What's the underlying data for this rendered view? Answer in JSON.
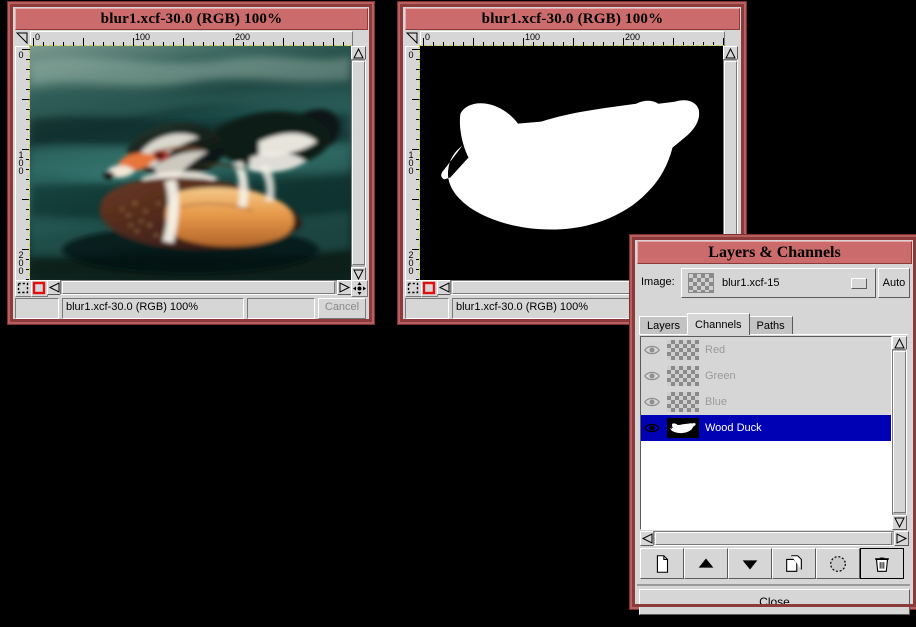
{
  "windows": [
    {
      "title": "blur1.xcf-30.0 (RGB) 100%",
      "status_text": "blur1.xcf-30.0 (RGB) 100%",
      "cancel_label": "Cancel",
      "ruler_labels_h": [
        "0",
        "100",
        "200"
      ],
      "ruler_labels_v": [
        "0",
        "100",
        "200"
      ],
      "canvas_kind": "photo-wood-duck"
    },
    {
      "title": "blur1.xcf-30.0 (RGB) 100%",
      "status_text": "blur1.xcf-30.0 (RGB) 100%",
      "cancel_label": "",
      "ruler_labels_h": [
        "0",
        "100",
        "200"
      ],
      "ruler_labels_v": [
        "0",
        "100",
        "200"
      ],
      "canvas_kind": "mask-duck-silhouette"
    }
  ],
  "dialog": {
    "title": "Layers & Channels",
    "image_label": "Image:",
    "image_value": "blur1.xcf-15",
    "auto_label": "Auto",
    "tabs": [
      {
        "label": "Layers",
        "active": false
      },
      {
        "label": "Channels",
        "active": true
      },
      {
        "label": "Paths",
        "active": false
      }
    ],
    "channels": [
      {
        "name": "Red",
        "selected": false,
        "visible": true,
        "thumb": "checker"
      },
      {
        "name": "Green",
        "selected": false,
        "visible": true,
        "thumb": "checker"
      },
      {
        "name": "Blue",
        "selected": false,
        "visible": true,
        "thumb": "checker"
      },
      {
        "name": "Wood Duck",
        "selected": true,
        "visible": true,
        "thumb": "mask"
      }
    ],
    "toolbar": [
      {
        "icon": "new-channel-icon",
        "active": false
      },
      {
        "icon": "raise-channel-icon",
        "active": false
      },
      {
        "icon": "lower-channel-icon",
        "active": false
      },
      {
        "icon": "duplicate-channel-icon",
        "active": false
      },
      {
        "icon": "channel-to-selection-icon",
        "active": false
      },
      {
        "icon": "delete-channel-icon",
        "active": true
      }
    ],
    "close_label": "Close"
  },
  "colors": {
    "titlebar": "#cb6b6b",
    "frame": "#8d3a3a",
    "face": "#d6d6d6",
    "selection": "#0000b5",
    "desktop": "#000000",
    "marching_ants": "#c9d13a"
  }
}
